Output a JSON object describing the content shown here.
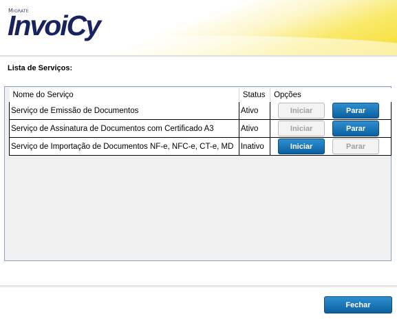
{
  "brand": {
    "small": "Migrate",
    "main": "InvoiCy"
  },
  "section_title": "Lista de Serviços:",
  "table": {
    "headers": [
      "Nome do Serviço",
      "Status",
      "Opções"
    ],
    "rows": [
      {
        "name": "Serviço de Emissão de Documentos",
        "status": "Ativo",
        "start_label": "Iniciar",
        "stop_label": "Parar",
        "start_enabled": false,
        "stop_enabled": true
      },
      {
        "name": "Serviço de Assinatura de Documentos com Certificado A3",
        "status": "Ativo",
        "start_label": "Iniciar",
        "stop_label": "Parar",
        "start_enabled": false,
        "stop_enabled": true
      },
      {
        "name": "Serviço de Importação de Documentos NF-e, NFC-e, CT-e, MD",
        "status": "Inativo",
        "start_label": "Iniciar",
        "stop_label": "Parar",
        "start_enabled": true,
        "stop_enabled": false
      }
    ]
  },
  "footer": {
    "close_label": "Fechar"
  },
  "colors": {
    "accent": "#0c5f9e",
    "brand": "#17235f",
    "header_yellow": "#f6de34"
  }
}
